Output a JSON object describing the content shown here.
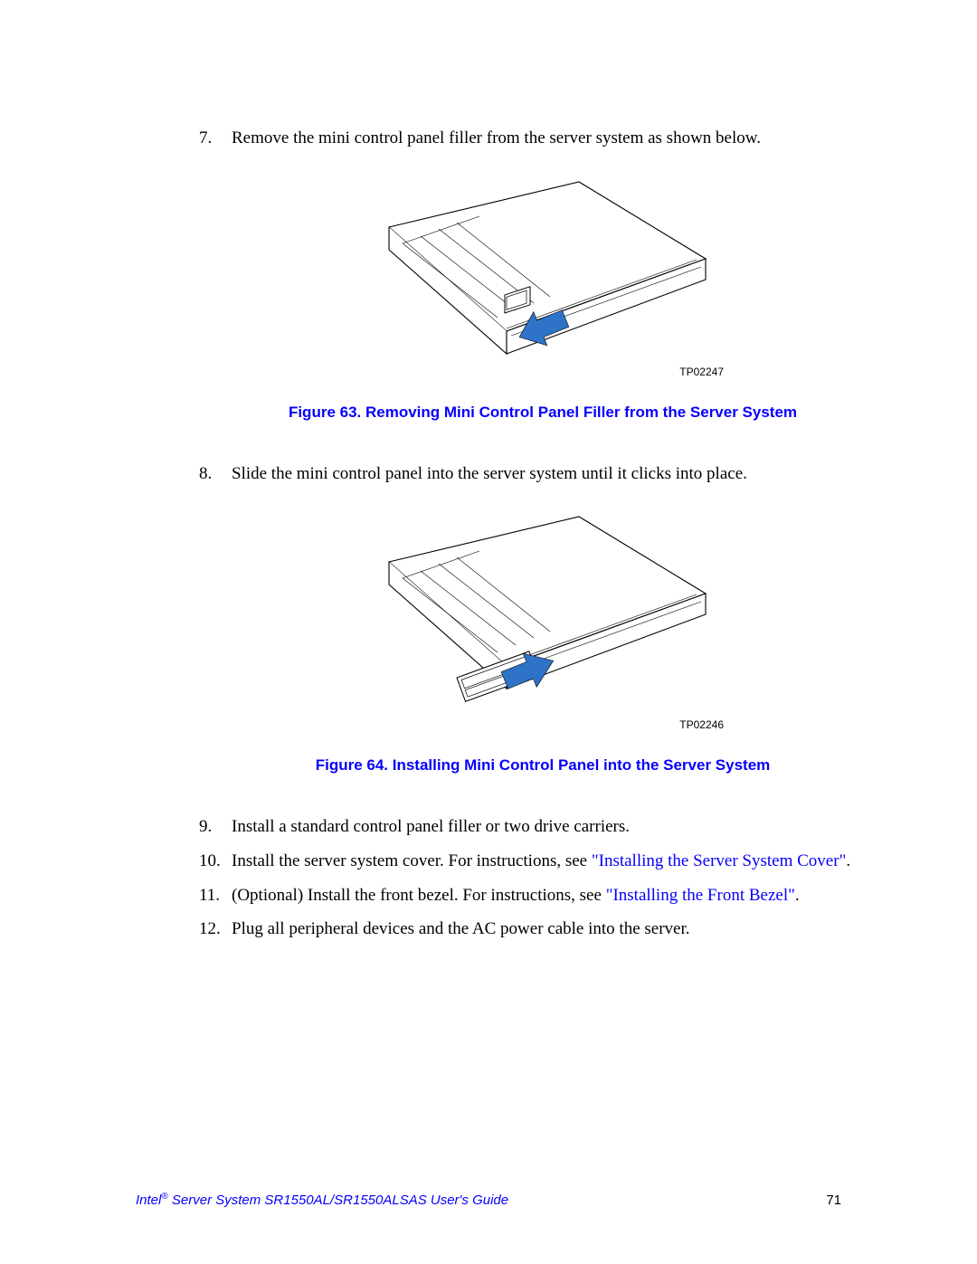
{
  "steps": {
    "7": {
      "num": "7.",
      "text": "Remove the mini control panel filler from the server system as shown below."
    },
    "8": {
      "num": "8.",
      "text": "Slide the mini control panel into the server system until it clicks into place."
    },
    "9": {
      "num": "9.",
      "text": "Install a standard control panel filler or two drive carriers."
    },
    "10": {
      "num": "10.",
      "prefix": "Install the server system cover. For instructions, see ",
      "link": "\"Installing the Server System Cover\"",
      "suffix": "."
    },
    "11": {
      "num": "11.",
      "prefix": "(Optional) Install the front bezel. For instructions, see ",
      "link": "\"Installing the Front Bezel\"",
      "suffix": "."
    },
    "12": {
      "num": "12.",
      "text": "Plug all peripheral devices and the AC power cable into the server."
    }
  },
  "figures": {
    "63": {
      "tp": "TP02247",
      "caption": "Figure 63. Removing Mini Control Panel Filler from the Server System"
    },
    "64": {
      "tp": "TP02246",
      "caption": "Figure 64. Installing Mini Control Panel into the Server System"
    }
  },
  "footer": {
    "title_prefix": "Intel",
    "title_sup": "®",
    "title_rest": " Server System SR1550AL/SR1550ALSAS User's Guide",
    "page": "71"
  }
}
